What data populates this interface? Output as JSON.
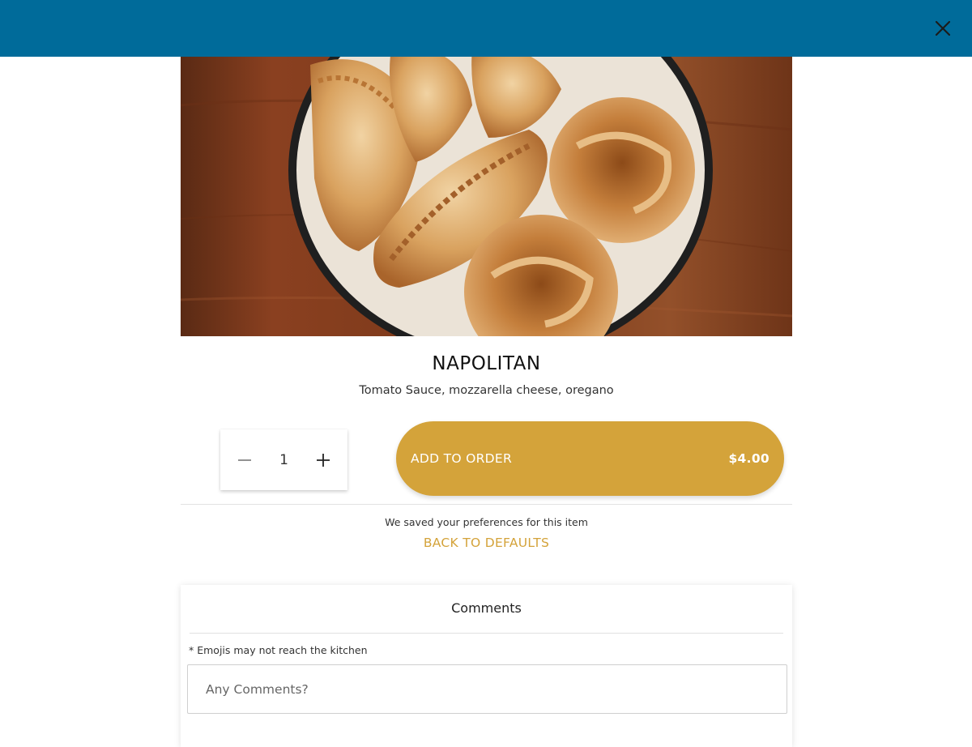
{
  "header": {
    "close_icon": "close-icon",
    "bar_color": "#006b9a"
  },
  "item": {
    "image_alt": "Plate of baked empanadas",
    "name": "NAPOLITAN",
    "description": "Tomato Sauce, mozzarella cheese, oregano"
  },
  "quantity": {
    "value": "1",
    "decrement_icon": "minus-icon",
    "increment_icon": "plus-icon"
  },
  "add_to_order": {
    "label": "ADD TO ORDER",
    "price": "$4.00",
    "color": "#d4a33a"
  },
  "preferences": {
    "note": "We saved your preferences for this item",
    "reset_label": "BACK TO DEFAULTS"
  },
  "comments": {
    "title": "Comments",
    "emoji_note": "* Emojis may not reach the kitchen",
    "placeholder": "Any Comments?"
  }
}
